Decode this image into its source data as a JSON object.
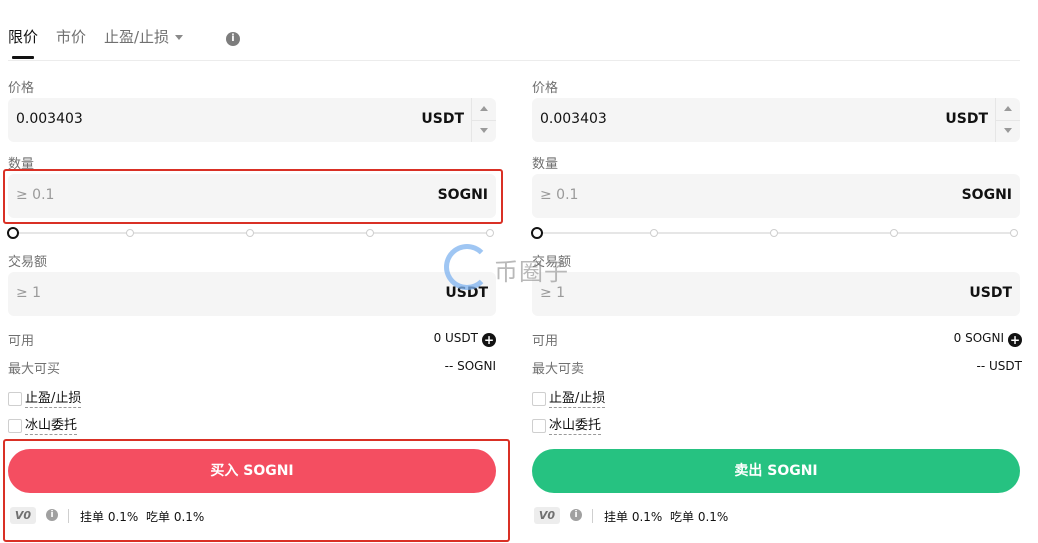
{
  "tabs": [
    {
      "label": "限价",
      "active": true
    },
    {
      "label": "市价",
      "active": false
    },
    {
      "label": "止盈/止损",
      "active": false
    }
  ],
  "buy": {
    "price_label": "价格",
    "price_value": "0.003403",
    "price_unit": "USDT",
    "qty_label": "数量",
    "qty_placeholder": "≥ 0.1",
    "qty_unit": "SOGNI",
    "amount_label": "交易额",
    "amount_placeholder": "≥ 1",
    "amount_unit": "USDT",
    "available_label": "可用",
    "available_value": "0 USDT",
    "max_label": "最大可买",
    "max_value": "-- SOGNI",
    "tp_sl_label": "止盈/止损",
    "iceberg_label": "冰山委托",
    "button_label": "买入 SOGNI",
    "vip": "V0",
    "maker_fee": "挂单 0.1%",
    "taker_fee": "吃单 0.1%"
  },
  "sell": {
    "price_label": "价格",
    "price_value": "0.003403",
    "price_unit": "USDT",
    "qty_label": "数量",
    "qty_placeholder": "≥ 0.1",
    "qty_unit": "SOGNI",
    "amount_label": "交易额",
    "amount_placeholder": "≥ 1",
    "amount_unit": "USDT",
    "available_label": "可用",
    "available_value": "0 SOGNI",
    "max_label": "最大可卖",
    "max_value": "-- USDT",
    "tp_sl_label": "止盈/止损",
    "iceberg_label": "冰山委托",
    "button_label": "卖出 SOGNI",
    "vip": "V0",
    "maker_fee": "挂单 0.1%",
    "taker_fee": "吃单 0.1%"
  },
  "watermark": "币圈子",
  "colors": {
    "buy": "#f44e61",
    "sell": "#26c281",
    "highlight": "#d93025"
  },
  "icons": [
    "info-icon",
    "plus-circle-icon",
    "chevron-down-icon",
    "stepper-up-icon",
    "stepper-down-icon"
  ]
}
